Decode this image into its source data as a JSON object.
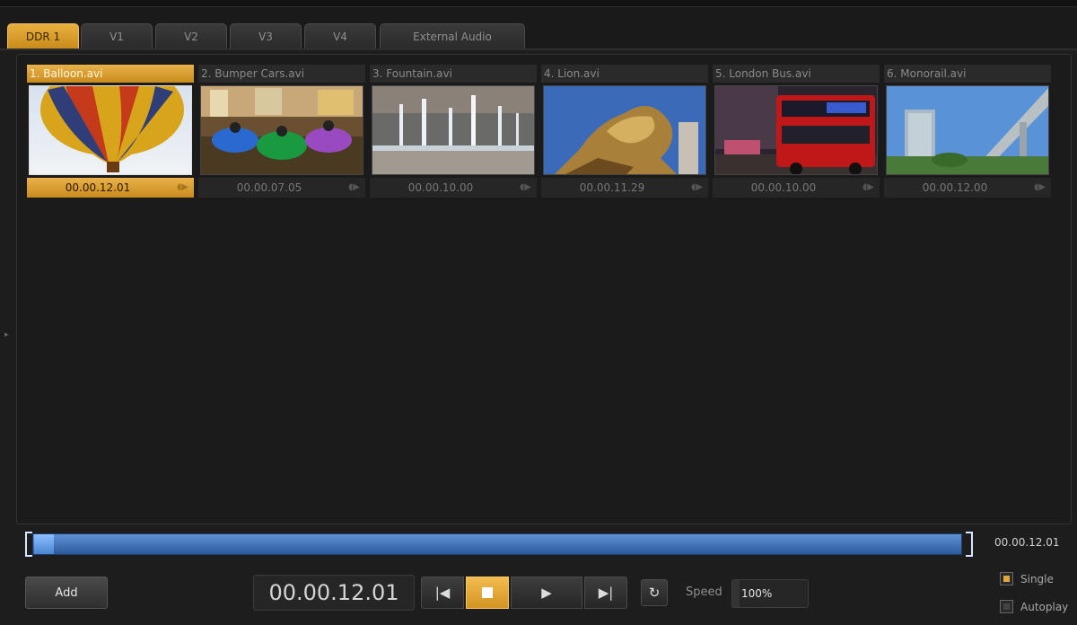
{
  "tabs": [
    "DDR 1",
    "V1",
    "V2",
    "V3",
    "V4",
    "External Audio"
  ],
  "active_tab": "DDR 1",
  "clips": [
    {
      "title": "1. Balloon.avi",
      "duration": "00.00.12.01",
      "selected": true
    },
    {
      "title": "2. Bumper Cars.avi",
      "duration": "00.00.07.05",
      "selected": false
    },
    {
      "title": "3. Fountain.avi",
      "duration": "00.00.10.00",
      "selected": false
    },
    {
      "title": "4. Lion.avi",
      "duration": "00.00.11.29",
      "selected": false
    },
    {
      "title": "5. London Bus.avi",
      "duration": "00.00.10.00",
      "selected": false
    },
    {
      "title": "6. Monorail.avi",
      "duration": "00.00.12.00",
      "selected": false
    }
  ],
  "scrubber": {
    "time": "00.00.12.01",
    "position": 0.0
  },
  "controls": {
    "add_label": "Add",
    "timecode": "00.00.12.01",
    "speed_label": "Speed",
    "speed_value": "100%",
    "single_label": "Single",
    "autoplay_label": "Autoplay",
    "single_checked": true,
    "autoplay_checked": false
  },
  "colors": {
    "accent": "#e0a83a",
    "scrubber": "#3f73bd",
    "background": "#1b1b1b"
  },
  "icons": {
    "prev": "skip-back-icon",
    "stop": "stop-icon",
    "play": "play-icon",
    "next": "skip-forward-icon",
    "loop": "loop-icon",
    "clip_action": "play-small-icon"
  }
}
